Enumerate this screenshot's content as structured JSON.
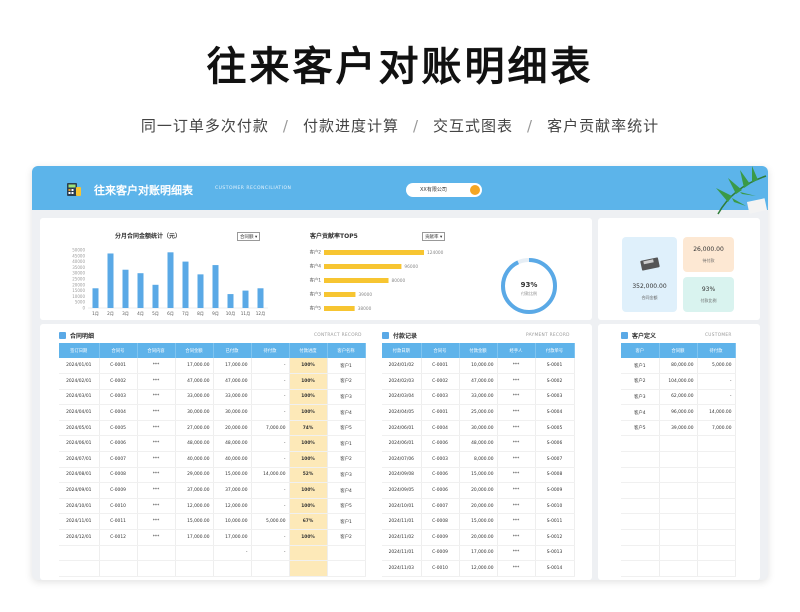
{
  "hero": {
    "title": "往来客户对账明细表",
    "features": [
      "同一订单多次付款",
      "付款进度计算",
      "交互式图表",
      "客户贡献率统计"
    ],
    "separator": "/"
  },
  "header": {
    "app_title": "往来客户对账明细表",
    "app_subtitle": "CUSTOMER RECONCILIATION",
    "company": "XX有限公司"
  },
  "colors": {
    "accent": "#5cb4ea",
    "bar_blue": "#5aa9e6",
    "bar_yellow": "#f7c531",
    "highlight": "#fde9b8",
    "ring": "#5aa9e6"
  },
  "charts": {
    "monthly": {
      "title": "分月合同金额统计（元）",
      "dropdown": "合同额"
    },
    "top5": {
      "title": "客户贡献率TOP5",
      "dropdown": "贡献率"
    },
    "ring": {
      "value": "93%",
      "label": "付款比例"
    }
  },
  "chart_data": [
    {
      "type": "bar",
      "title": "分月合同金额统计（元）",
      "categories": [
        "1月",
        "2月",
        "3月",
        "4月",
        "5月",
        "6月",
        "7月",
        "8月",
        "9月",
        "10月",
        "11月",
        "12月"
      ],
      "values": [
        17000,
        47000,
        33000,
        30000,
        20000,
        48000,
        40000,
        29000,
        37000,
        12000,
        15000,
        17000
      ],
      "yticks": [
        "0",
        "5000",
        "10000",
        "15000",
        "20000",
        "25000",
        "30000",
        "35000",
        "40000",
        "45000",
        "50000"
      ],
      "ylim": [
        0,
        50000
      ]
    },
    {
      "type": "bar",
      "orientation": "horizontal",
      "title": "客户贡献率TOP5",
      "categories": [
        "客户2",
        "客户4",
        "客户1",
        "客户3",
        "客户5"
      ],
      "values": [
        124000,
        96000,
        80000,
        39000,
        38000
      ],
      "labels": [
        "124000",
        "96000",
        "80000",
        "39000",
        "38000"
      ]
    },
    {
      "type": "pie",
      "title": "付款比例",
      "values": [
        93,
        7
      ],
      "center_label": "93%"
    }
  ],
  "stats": [
    {
      "value": "352,000.00",
      "label": "合同金额"
    },
    {
      "value": "26,000.00",
      "label": "待付款"
    },
    {
      "value": "93%",
      "label": "付款比例"
    }
  ],
  "contracts": {
    "title": "合同明细",
    "title_en": "CONTRACT RECORD",
    "columns": [
      "签订日期",
      "合同号",
      "合同内容",
      "合同金额",
      "已付款",
      "待付款",
      "付款进度",
      "客户名称"
    ],
    "rows": [
      [
        "2024/01/01",
        "C-0001",
        "***",
        "17,000.00",
        "17,000.00",
        "-",
        "100%",
        "客户1"
      ],
      [
        "2024/02/01",
        "C-0002",
        "***",
        "47,000.00",
        "47,000.00",
        "-",
        "100%",
        "客户2"
      ],
      [
        "2024/03/01",
        "C-0003",
        "***",
        "33,000.00",
        "33,000.00",
        "-",
        "100%",
        "客户3"
      ],
      [
        "2024/04/01",
        "C-0004",
        "***",
        "30,000.00",
        "30,000.00",
        "-",
        "100%",
        "客户4"
      ],
      [
        "2024/05/01",
        "C-0005",
        "***",
        "27,000.00",
        "20,000.00",
        "7,000.00",
        "74%",
        "客户5"
      ],
      [
        "2024/06/01",
        "C-0006",
        "***",
        "48,000.00",
        "48,000.00",
        "-",
        "100%",
        "客户1"
      ],
      [
        "2024/07/01",
        "C-0007",
        "***",
        "40,000.00",
        "40,000.00",
        "-",
        "100%",
        "客户2"
      ],
      [
        "2024/08/01",
        "C-0008",
        "***",
        "29,000.00",
        "15,000.00",
        "14,000.00",
        "52%",
        "客户3"
      ],
      [
        "2024/09/01",
        "C-0009",
        "***",
        "37,000.00",
        "37,000.00",
        "-",
        "100%",
        "客户4"
      ],
      [
        "2024/10/01",
        "C-0010",
        "***",
        "12,000.00",
        "12,000.00",
        "-",
        "100%",
        "客户5"
      ],
      [
        "2024/11/01",
        "C-0011",
        "***",
        "15,000.00",
        "10,000.00",
        "5,000.00",
        "67%",
        "客户1"
      ],
      [
        "2024/12/01",
        "C-0012",
        "***",
        "17,000.00",
        "17,000.00",
        "-",
        "100%",
        "客户2"
      ],
      [
        "",
        "",
        "",
        "",
        "-",
        "-",
        "",
        ""
      ],
      [
        "",
        "",
        "",
        "",
        "",
        "",
        "",
        ""
      ]
    ]
  },
  "payments": {
    "title": "付款记录",
    "title_en": "PAYMENT RECORD",
    "columns": [
      "付款日期",
      "合同号",
      "付款金额",
      "经手人",
      "付款单号"
    ],
    "rows": [
      [
        "2024/01/02",
        "C-0001",
        "10,000.00",
        "***",
        "S-0001"
      ],
      [
        "2024/02/03",
        "C-0002",
        "47,000.00",
        "***",
        "S-0002"
      ],
      [
        "2024/03/04",
        "C-0003",
        "33,000.00",
        "***",
        "S-0003"
      ],
      [
        "2024/04/05",
        "C-0001",
        "25,000.00",
        "***",
        "S-0004"
      ],
      [
        "2024/06/01",
        "C-0004",
        "30,000.00",
        "***",
        "S-0005"
      ],
      [
        "2024/06/01",
        "C-0006",
        "48,000.00",
        "***",
        "S-0006"
      ],
      [
        "2024/07/06",
        "C-0003",
        "8,000.00",
        "***",
        "S-0007"
      ],
      [
        "2024/09/08",
        "C-0006",
        "15,000.00",
        "***",
        "S-0008"
      ],
      [
        "2024/09/05",
        "C-0006",
        "20,000.00",
        "***",
        "S-0009"
      ],
      [
        "2024/10/01",
        "C-0007",
        "20,000.00",
        "***",
        "S-0010"
      ],
      [
        "2024/11/01",
        "C-0008",
        "15,000.00",
        "***",
        "S-0011"
      ],
      [
        "2024/11/02",
        "C-0009",
        "20,000.00",
        "***",
        "S-0012"
      ],
      [
        "2024/11/01",
        "C-0009",
        "17,000.00",
        "***",
        "S-0013"
      ],
      [
        "2024/11/03",
        "C-0010",
        "12,000.00",
        "***",
        "S-0014"
      ]
    ]
  },
  "customers": {
    "title": "客户定义",
    "title_en": "CUSTOMER",
    "columns": [
      "客户",
      "合同额",
      "待付款"
    ],
    "rows": [
      [
        "客户1",
        "80,000.00",
        "5,000.00"
      ],
      [
        "客户2",
        "104,000.00",
        "-"
      ],
      [
        "客户3",
        "62,000.00",
        "-"
      ],
      [
        "客户4",
        "96,000.00",
        "14,000.00"
      ],
      [
        "客户5",
        "39,000.00",
        "7,000.00"
      ]
    ]
  }
}
